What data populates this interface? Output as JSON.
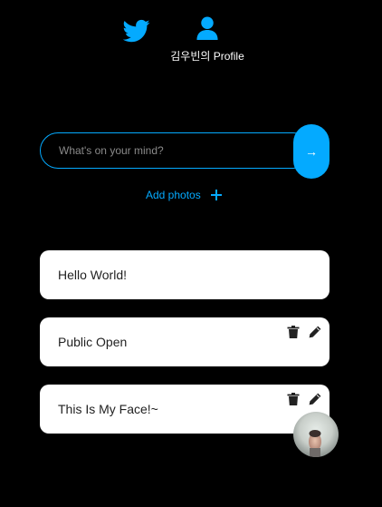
{
  "nav": {
    "home_icon": "twitter-bird-icon",
    "profile_icon": "user-icon",
    "profile_label": "김우빈의 Profile"
  },
  "composer": {
    "placeholder": "What's on your mind?",
    "submit_label": "→",
    "add_photos_label": "Add photos",
    "add_photos_icon": "plus-icon"
  },
  "tweets": [
    {
      "text": "Hello World!",
      "editable": false
    },
    {
      "text": "Public Open",
      "editable": true
    },
    {
      "text": "This Is My Face!~",
      "editable": true,
      "has_attachment": true
    }
  ],
  "colors": {
    "background": "#000000",
    "accent": "#04aaff",
    "card": "#ffffff",
    "card_text": "#222222"
  }
}
